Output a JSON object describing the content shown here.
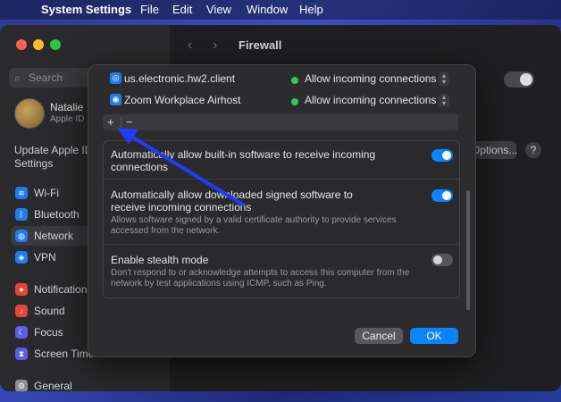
{
  "menubar": {
    "app_name": "System Settings",
    "items": [
      "File",
      "Edit",
      "View",
      "Window",
      "Help"
    ]
  },
  "sidebar": {
    "search_placeholder": "Search",
    "user_name": "Natalie",
    "user_sub": "Apple ID",
    "update_label": "Update Apple ID Settings",
    "items": [
      {
        "label": "Wi-Fi",
        "icon": "wifi-icon",
        "color": "#1e7cf2"
      },
      {
        "label": "Bluetooth",
        "icon": "bluetooth-icon",
        "color": "#1e7cf2"
      },
      {
        "label": "Network",
        "icon": "network-icon",
        "color": "#1e7cf2"
      },
      {
        "label": "VPN",
        "icon": "vpn-icon",
        "color": "#1e7cf2"
      },
      {
        "label": "Notifications",
        "icon": "bell-icon",
        "color": "#e5453a"
      },
      {
        "label": "Sound",
        "icon": "speaker-icon",
        "color": "#e5453a"
      },
      {
        "label": "Focus",
        "icon": "moon-icon",
        "color": "#5e5ce6"
      },
      {
        "label": "Screen Time",
        "icon": "hourglass-icon",
        "color": "#5e5ce6"
      },
      {
        "label": "General",
        "icon": "gear-icon",
        "color": "#8e8e93"
      }
    ]
  },
  "main": {
    "title": "Firewall",
    "options_button": "Options...",
    "help": "?"
  },
  "sheet": {
    "apps": [
      {
        "name": "us.electronic.hw2.client",
        "status": "Allow incoming connections",
        "icon": "globe-icon"
      },
      {
        "name": "Zoom Workplace Airhost",
        "status": "Allow incoming connections",
        "icon": "zoom-icon"
      }
    ],
    "add": "+",
    "remove": "−",
    "options": [
      {
        "title": "Automatically allow built-in software to receive incoming connections",
        "desc": "",
        "on": true
      },
      {
        "title": "Automatically allow downloaded signed software to receive incoming connections",
        "desc": "Allows software signed by a valid certificate authority to provide services accessed from the network.",
        "on": true
      },
      {
        "title": "Enable stealth mode",
        "desc": "Don't respond to or acknowledge attempts to access this computer from the network by test applications using ICMP, such as Ping.",
        "on": false
      }
    ],
    "cancel": "Cancel",
    "ok": "OK"
  },
  "colors": {
    "accent": "#0a84ff",
    "allow_dot": "#34c759",
    "annotation_arrow": "#1f3bff"
  }
}
